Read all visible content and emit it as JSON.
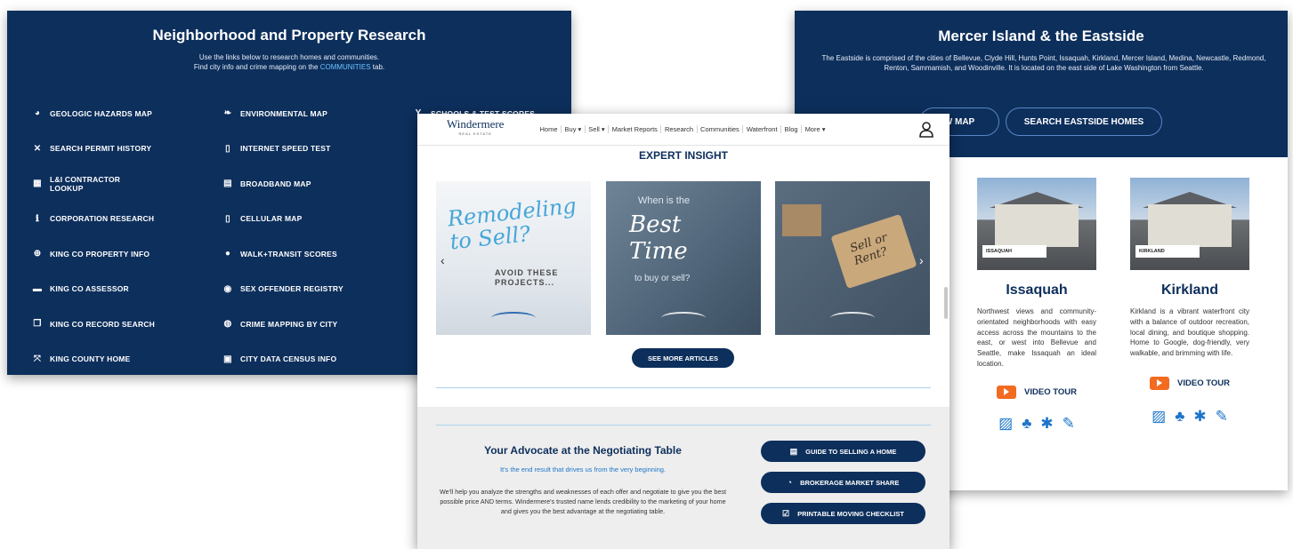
{
  "left_panel": {
    "title": "Neighborhood and Property Research",
    "subtitle_line1": "Use the links below to research homes and communities.",
    "subtitle_line2_prefix": "Find city info and crime mapping on the ",
    "subtitle_link": "COMMUNITIES",
    "subtitle_line2_suffix": " tab.",
    "column1": [
      {
        "label": "GEOLOGIC HAZARDS MAP",
        "icon": "globe-icon"
      },
      {
        "label": "SEARCH PERMIT HISTORY",
        "icon": "tools-icon"
      },
      {
        "label": "L&I CONTRACTOR LOOKUP",
        "icon": "calendar-icon"
      },
      {
        "label": "CORPORATION RESEARCH",
        "icon": "info-icon"
      },
      {
        "label": "KING CO PROPERTY INFO",
        "icon": "search-icon"
      },
      {
        "label": "KING CO ASSESSOR",
        "icon": "card-icon"
      },
      {
        "label": "KING CO RECORD SEARCH",
        "icon": "records-icon"
      },
      {
        "label": "KING COUNTY HOME",
        "icon": "expand-icon"
      }
    ],
    "column2": [
      {
        "label": "ENVIRONMENTAL MAP",
        "icon": "leaf-icon"
      },
      {
        "label": "INTERNET SPEED TEST",
        "icon": "device-icon"
      },
      {
        "label": "BROADBAND MAP",
        "icon": "broadband-icon"
      },
      {
        "label": "CELLULAR MAP",
        "icon": "cellular-icon"
      },
      {
        "label": "WALK+TRANSIT SCORES",
        "icon": "pin-icon"
      },
      {
        "label": "SEX OFFENDER REGISTRY",
        "icon": "eye-icon"
      },
      {
        "label": "CRIME MAPPING BY CITY",
        "icon": "crime-icon"
      },
      {
        "label": "CITY DATA CENSUS INFO",
        "icon": "list-icon"
      }
    ],
    "column3": [
      {
        "label": "SCHOOLS & TEST SCORES",
        "icon": "school-icon"
      }
    ]
  },
  "right_panel": {
    "title": "Mercer Island & the Eastside",
    "description": "The Eastside is comprised of the cities of Bellevue, Clyde Hill, Hunts Point, Issaquah, Kirkland, Mercer Island, Medina, Newcastle, Redmond, Renton, Sammamish, and Woodinville. It is located on the east side of Lake Washington from Seattle.",
    "view_map_label": "W MAP",
    "search_label": "SEARCH EASTSIDE HOMES",
    "cities": [
      {
        "name": "Issaquah",
        "tag": "ISSAQUAH",
        "description": "Northwest views and community-orientated neighborhoods with easy access across the mountains to the east, or west into Bellevue and Seattle, make Issaquah an ideal location.",
        "video_label": "VIDEO TOUR"
      },
      {
        "name": "Kirkland",
        "tag": "KIRKLAND",
        "description": "Kirkland is a vibrant waterfront city with a balance of outdoor recreation, local dining, and boutique shopping. Home to Google, dog-friendly, very walkable, and brimming with life.",
        "video_label": "VIDEO TOUR"
      }
    ]
  },
  "center_panel": {
    "logo": "Windermere",
    "logo_sub": "REAL ESTATE",
    "nav": [
      "Home",
      "Buy ▾",
      "Sell ▾",
      "Market Reports",
      "Research",
      "Communities",
      "Waterfront",
      "Blog",
      "More ▾"
    ],
    "section_title": "EXPERT INSIGHT",
    "articles": [
      {
        "line1": "Remodeling",
        "line2": "to Sell?",
        "line3": "AVOID THESE",
        "line4": "PROJECTS..."
      },
      {
        "line1": "When is the",
        "line2": "Best",
        "line3": "Time",
        "line4": "to buy or sell?"
      },
      {
        "line1": "Sell or",
        "line2": "Rent?"
      }
    ],
    "see_more_label": "SEE MORE ARTICLES",
    "advocate_title": "Your Advocate at the Negotiating Table",
    "advocate_subtitle": "It's the end result that drives us from the very beginning.",
    "advocate_body": "We'll help you analyze the strengths and weaknesses of each offer and negotiate to give you the best possible price AND terms. Windermere's trusted name lends credibility to the marketing of your home and gives you the best advantage at the negotiating table.",
    "buttons": [
      "GUIDE TO SELLING A HOME",
      "BROKERAGE MARKET SHARE",
      "PRINTABLE MOVING CHECKLIST"
    ]
  },
  "colors": {
    "navy": "#0d2f5c",
    "accent_blue": "#1c75c9",
    "youtube_orange": "#f26b20"
  }
}
